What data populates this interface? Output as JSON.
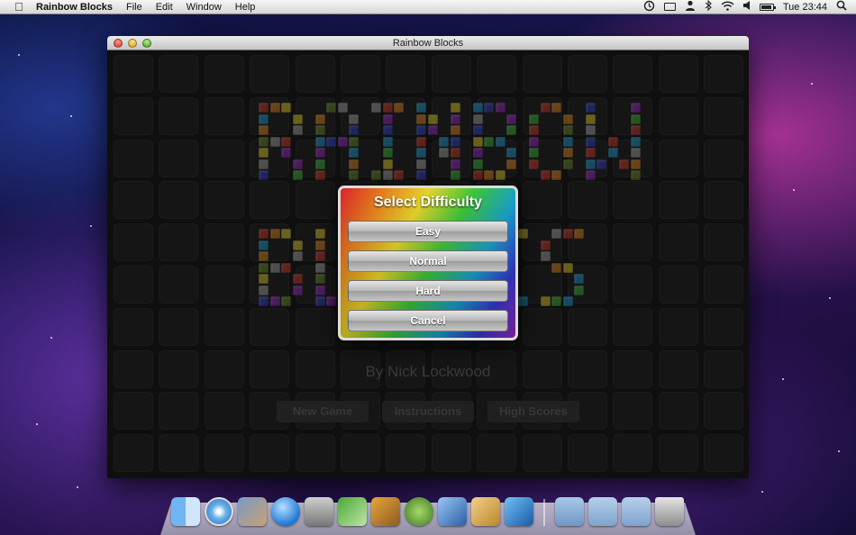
{
  "menubar": {
    "app_name": "Rainbow Blocks",
    "menus": [
      "File",
      "Edit",
      "Window",
      "Help"
    ],
    "clock": "Tue 23:44",
    "status_icons": [
      "time-machine-icon",
      "display-icon",
      "user-icon",
      "bluetooth-icon",
      "wifi-icon",
      "volume-icon",
      "battery-icon",
      "spotlight-icon"
    ]
  },
  "window": {
    "title": "Rainbow Blocks"
  },
  "game": {
    "logo_line1": "RAINBOW",
    "logo_line2": "BLOCKS",
    "author": "By Nick Lockwood",
    "menu_buttons": [
      "New Game",
      "Instructions",
      "High Scores"
    ]
  },
  "dialog": {
    "title": "Select Difficulty",
    "buttons": [
      "Easy",
      "Normal",
      "Hard",
      "Cancel"
    ]
  },
  "dock": {
    "apps": [
      "finder-icon",
      "safari-icon",
      "iphoto-icon",
      "itunes-icon",
      "system-preferences-icon",
      "numbers-icon",
      "transmit-icon",
      "growl-icon",
      "xcode-icon",
      "instruments-icon",
      "ios-simulator-icon"
    ],
    "folders": [
      "applications-folder-icon",
      "documents-folder-icon",
      "downloads-folder-icon",
      "trash-icon"
    ]
  }
}
